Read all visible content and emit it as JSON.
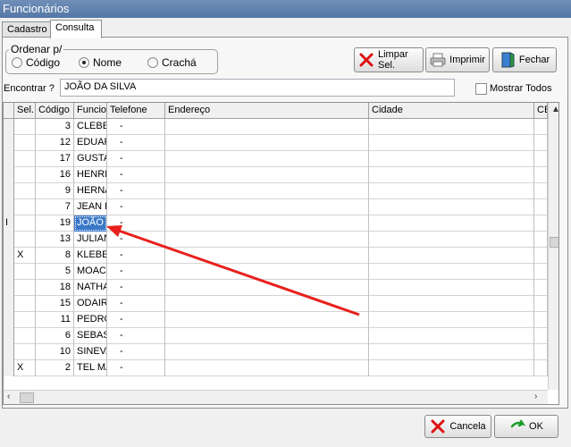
{
  "window": {
    "title": "Funcionários"
  },
  "tabs": [
    {
      "label": "Cadastro"
    },
    {
      "label": "Consulta"
    }
  ],
  "order": {
    "legend": "Ordenar p/",
    "options": [
      {
        "label": "Código",
        "checked": false
      },
      {
        "label": "Nome",
        "checked": true
      },
      {
        "label": "Crachá",
        "checked": false
      }
    ]
  },
  "toolbar": {
    "clear_label": "Limpar Sel.",
    "print_label": "Imprimir",
    "close_label": "Fechar"
  },
  "search": {
    "label": "Encontrar ?",
    "value": "JOÃO DA SILVA"
  },
  "show_all": {
    "label": "Mostrar Todos",
    "checked": false
  },
  "grid": {
    "columns": [
      "Sel.",
      "Código",
      "Funcio",
      "Telefone",
      "Endereço",
      "Cidade",
      "CE"
    ],
    "rows": [
      {
        "sel": "",
        "code": "3",
        "name": "CLEBER",
        "phone": "-"
      },
      {
        "sel": "",
        "code": "12",
        "name": "EDUAR",
        "phone": "-"
      },
      {
        "sel": "",
        "code": "17",
        "name": "GUSTA",
        "phone": "-"
      },
      {
        "sel": "",
        "code": "16",
        "name": "HENRI",
        "phone": "-"
      },
      {
        "sel": "",
        "code": "9",
        "name": "HERNA",
        "phone": "-"
      },
      {
        "sel": "",
        "code": "7",
        "name": "JEAN L",
        "phone": "-"
      },
      {
        "sel": "",
        "code": "19",
        "name": "JOÃO",
        "phone": "-"
      },
      {
        "sel": "",
        "code": "13",
        "name": "JULIAN",
        "phone": "-"
      },
      {
        "sel": "X",
        "code": "8",
        "name": "KLEBER",
        "phone": "-"
      },
      {
        "sel": "",
        "code": "5",
        "name": "MOACI",
        "phone": "-"
      },
      {
        "sel": "",
        "code": "18",
        "name": "NATHA",
        "phone": "-"
      },
      {
        "sel": "",
        "code": "15",
        "name": "ODAIR",
        "phone": "-"
      },
      {
        "sel": "",
        "code": "11",
        "name": "PEDRO",
        "phone": "-"
      },
      {
        "sel": "",
        "code": "6",
        "name": "SEBAS",
        "phone": "-"
      },
      {
        "sel": "",
        "code": "10",
        "name": "SINEVA",
        "phone": "-"
      },
      {
        "sel": "X",
        "code": "2",
        "name": "TEL MA",
        "phone": "-"
      }
    ],
    "selected_row": 6
  },
  "footer": {
    "cancel_label": "Cancela",
    "ok_label": "OK"
  },
  "colors": {
    "accent": "#3a78c7",
    "annotation_arrow": "#e8201c",
    "titlebar": "#5f80ad"
  },
  "icons": [
    "red-x-icon",
    "printer-icon",
    "door-exit-icon",
    "green-check-icon"
  ]
}
